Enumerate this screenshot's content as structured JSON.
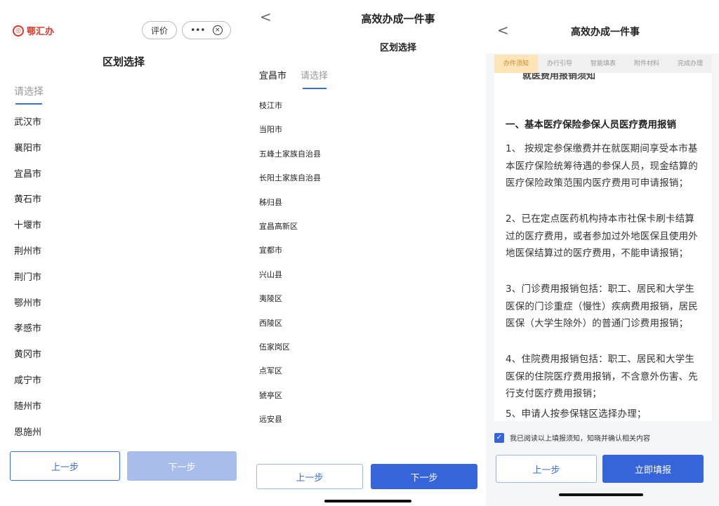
{
  "panel1": {
    "brand": "鄂汇办",
    "eval_label": "评价",
    "more_label": "•••",
    "close_label": "×",
    "title": "区划选择",
    "tab_placeholder": "请选择",
    "cities": [
      "武汉市",
      "襄阳市",
      "宜昌市",
      "黄石市",
      "十堰市",
      "荆州市",
      "荆门市",
      "鄂州市",
      "孝感市",
      "黄冈市",
      "咸宁市",
      "随州市",
      "恩施州"
    ],
    "prev_label": "上一步",
    "next_label": "下一步"
  },
  "panel2": {
    "back": "<",
    "header": "高效办成一件事",
    "subtitle": "区划选择",
    "selected_city": "宜昌市",
    "tab_placeholder": "请选择",
    "districts": [
      "枝江市",
      "当阳市",
      "五峰土家族自治县",
      "长阳土家族自治县",
      "秭归县",
      "宜昌高新区",
      "宜都市",
      "兴山县",
      "夷陵区",
      "西陵区",
      "伍家岗区",
      "点军区",
      "猇亭区",
      "远安县"
    ],
    "prev_label": "上一步",
    "next_label": "下一步"
  },
  "panel3": {
    "back": "<",
    "header": "高效办成一件事",
    "steps": [
      "办件须知",
      "办行引导",
      "智能填表",
      "附件材料",
      "完成办理"
    ],
    "cut_line": "就医费用报销须知",
    "section_heading": "一、基本医疗保险参保人员医疗费用报销",
    "paragraphs": [
      "1、 按规定参保缴费并在就医期间享受本市基本医疗保险统筹待遇的参保人员，现金结算的医疗保险政策范围内医疗费用可申请报销；",
      "2、已在定点医药机构持本市社保卡刷卡结算过的医疗费用，或者参加过外地医保且使用外地医保结算过的医疗费用，不能申请报销；",
      "3、门诊费用报销包括：职工、居民和大学生医保的门诊重症（慢性）疾病费用报销，居民医保（大学生除外）的普通门诊费用报销；",
      "4、住院费用报销包括：职工、居民和大学生医保的住院医疗费用报销，不含意外伤害、先行支付医疗费用报销；",
      "5、申请人按参保辖区选择办理；"
    ],
    "agree_text": "我已阅读以上填报须知，知晓并确认相关内容",
    "prev_label": "上一步",
    "submit_label": "立即填报"
  }
}
